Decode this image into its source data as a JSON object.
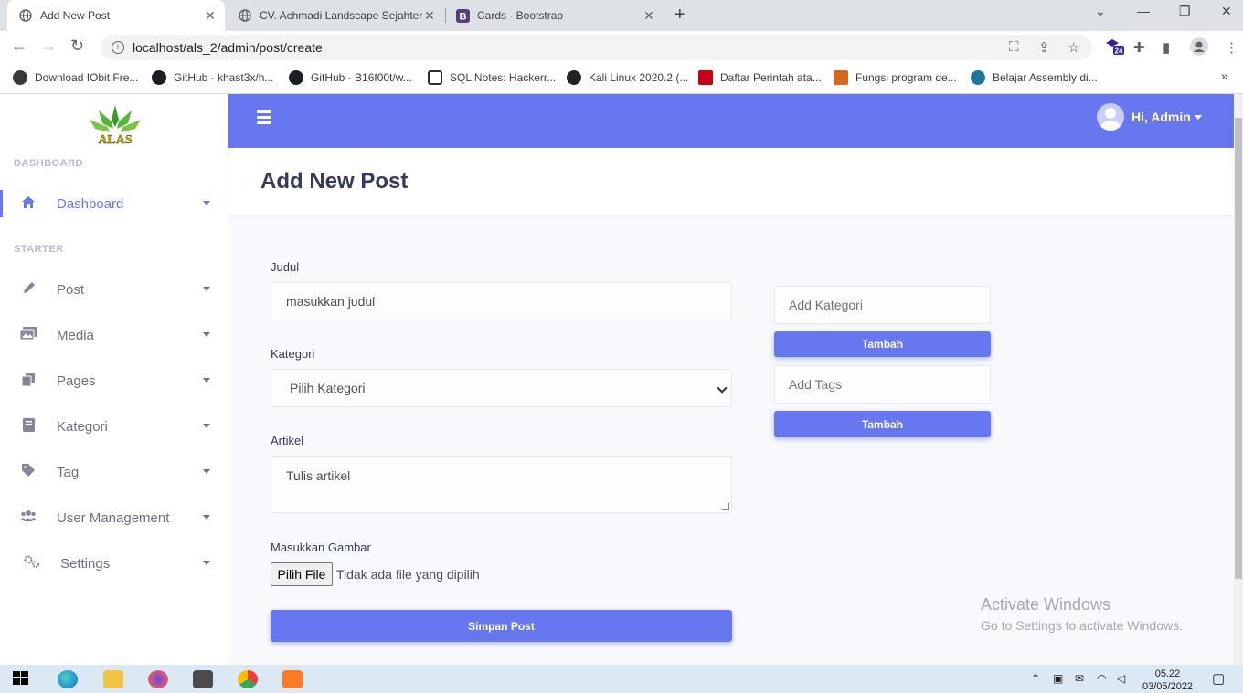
{
  "browser": {
    "tabs": [
      {
        "title": "Add New Post",
        "icon": "globe-icon"
      },
      {
        "title": "CV. Achmadi Landscape Sejahtera",
        "icon": "globe-icon"
      },
      {
        "title": "Cards · Bootstrap",
        "icon": "bootstrap-icon"
      }
    ],
    "url": "localhost/als_2/admin/post/create",
    "extension_badge": "24",
    "bookmarks": [
      {
        "label": "Download IObit Fre...",
        "icon": "iobit-icon"
      },
      {
        "label": "GitHub - khast3x/h...",
        "icon": "github-icon"
      },
      {
        "label": "GitHub - B16f00t/w...",
        "icon": "github-icon"
      },
      {
        "label": "SQL Notes: Hackerr...",
        "icon": "hackerrank-icon"
      },
      {
        "label": "Kali Linux 2020.2 (...",
        "icon": "kali-icon"
      },
      {
        "label": "Daftar Perintah ata...",
        "icon": "bookmark-m-icon"
      },
      {
        "label": "Fungsi program de...",
        "icon": "bookmark-img-icon"
      },
      {
        "label": "Belajar Assembly di...",
        "icon": "wordpress-icon"
      }
    ]
  },
  "sidebar": {
    "logo_text": "ALAS",
    "sections": {
      "dashboard": "DASHBOARD",
      "starter": "STARTER"
    },
    "items": [
      {
        "label": "Dashboard",
        "icon": "home-icon",
        "active": true
      },
      {
        "label": "Post",
        "icon": "pencil-icon"
      },
      {
        "label": "Media",
        "icon": "images-icon"
      },
      {
        "label": "Pages",
        "icon": "copy-icon"
      },
      {
        "label": "Kategori",
        "icon": "book-icon"
      },
      {
        "label": "Tag",
        "icon": "tag-icon"
      },
      {
        "label": "User Management",
        "icon": "users-icon"
      },
      {
        "label": "Settings",
        "icon": "cogs-icon"
      }
    ]
  },
  "topbar": {
    "greeting": "Hi, Admin"
  },
  "page": {
    "title": "Add New Post"
  },
  "form": {
    "judul": {
      "label": "Judul",
      "placeholder": "masukkan judul"
    },
    "kategori": {
      "label": "Kategori",
      "selected": "Pilih Kategori"
    },
    "artikel": {
      "label": "Artikel",
      "placeholder": "Tulis artikel"
    },
    "gambar": {
      "label": "Masukkan Gambar",
      "button": "Pilih File",
      "status": "Tidak ada file yang dipilih"
    },
    "submit": "Simpan Post"
  },
  "side_panel": {
    "kategori_placeholder": "Add Kategori",
    "kategori_button": "Tambah",
    "tags_placeholder": "Add Tags",
    "tags_button": "Tambah"
  },
  "watermark": {
    "title": "Activate Windows",
    "subtitle": "Go to Settings to activate Windows."
  },
  "taskbar": {
    "time": "05.22",
    "date": "03/05/2022"
  },
  "colors": {
    "accent": "#6777ef",
    "sidebar_bg": "#ffffff",
    "page_bg": "#f8f9fc"
  }
}
